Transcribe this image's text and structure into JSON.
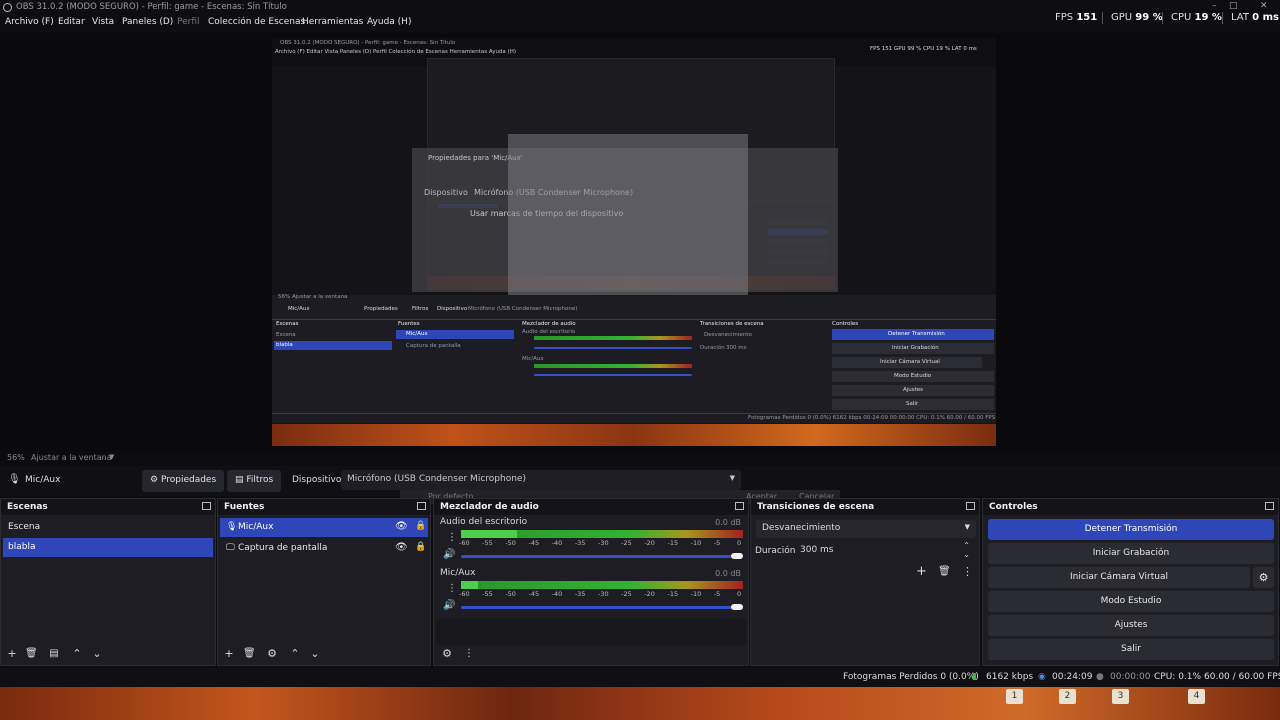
{
  "window": {
    "title": "OBS 31.0.2 (MODO SEGURO) - Perfil: game - Escenas: Sin Título",
    "controls": [
      "–",
      "□",
      "✕"
    ]
  },
  "menu": {
    "items": [
      "Archivo (F)",
      "Editar",
      "Vista",
      "Paneles (D)",
      "Perfil",
      "Colección de Escenas",
      "Herramientas",
      "Ayuda (H)"
    ]
  },
  "stats": {
    "fps_label": "FPS",
    "fps_value": "151",
    "gpu_label": "GPU",
    "gpu_value": "99 %",
    "cpu_label": "CPU",
    "cpu_value": "19 %",
    "lat_label": "LAT",
    "lat_value": "0 ms"
  },
  "preview": {
    "nested_title": "OBS 31.0.2 (MODO SEGURO) - Perfil: game - Escenas: Sin Título",
    "nested_menu": "Archivo (F)   Editar   Vista   Paneles (D)   Perfil   Colección de Escenas   Herramientas   Ayuda (H)",
    "nested_stats": "FPS 151   GPU 99 %   CPU 19 %   LAT 0 ms",
    "dialog_title": "Propiedades para 'Mic/Aux'",
    "dialog_device_label": "Dispositivo",
    "dialog_device_value": "Micrófono (USB Condenser Microphone)",
    "dialog_checkbox": "Usar marcas de tiempo del dispositivo",
    "nested_zoom": "56%   Ajustar a la ventana",
    "nested_source": "Mic/Aux",
    "nested_props": "Propiedades",
    "nested_filters": "Filtros",
    "nested_device": "Dispositivo",
    "nested_device_value": "Micrófono (USB Condenser Microphone)",
    "nested_docks": [
      "Escenas",
      "Fuentes",
      "Mezclador de audio",
      "Transiciones de escena",
      "Controles"
    ],
    "nested_scenes": [
      "Escena",
      "blabla"
    ],
    "nested_sources": [
      "Mic/Aux",
      "Captura de pantalla"
    ],
    "nested_mixer": [
      "Audio del escritorio",
      "Mic/Aux"
    ],
    "nested_transition": "Desvanecimiento",
    "nested_duration_label": "Duración",
    "nested_duration_value": "300 ms",
    "nested_controls": [
      "Detener Transmisión",
      "Iniciar Grabación",
      "Iniciar Cámara Virtual",
      "Modo Estudio",
      "Ajustes",
      "Salir"
    ],
    "nested_status": "Fotogramas Perdidos 0 (0.0%)   6162 kbps   00:24:09   00:00:00   CPU: 0.1%   60.00 / 60.00 FPS"
  },
  "zoom": {
    "percent": "56%",
    "mode": "Ajustar a la ventana"
  },
  "source_bar": {
    "source_name": "Mic/Aux",
    "properties_label": "Propiedades",
    "filters_label": "Filtros",
    "device_label": "Dispositivo",
    "device_value": "Micrófono (USB Condenser Microphone)",
    "ghost_default": "Por defecto",
    "ghost_accept": "Aceptar",
    "ghost_cancel": "Cancelar"
  },
  "scenes": {
    "title": "Escenas",
    "items": [
      "Escena",
      "blabla"
    ],
    "selected_index": 1
  },
  "sources": {
    "title": "Fuentes",
    "items": [
      "Mic/Aux",
      "Captura de pantalla"
    ],
    "selected_index": 0
  },
  "mixer": {
    "title": "Mezclador de audio",
    "channels": [
      {
        "name": "Audio del escritorio",
        "db": "0.0 dB",
        "level": 0.2,
        "volume": 1.0
      },
      {
        "name": "Mic/Aux",
        "db": "0.0 dB",
        "level": 0.06,
        "volume": 1.0
      }
    ],
    "scale": [
      "-60",
      "-55",
      "-50",
      "-45",
      "-40",
      "-35",
      "-30",
      "-25",
      "-20",
      "-15",
      "-10",
      "-5",
      "0"
    ]
  },
  "transitions": {
    "title": "Transiciones de escena",
    "selected": "Desvanecimiento",
    "duration_label": "Duración",
    "duration_value": "300 ms"
  },
  "controls": {
    "title": "Controles",
    "stop_stream": "Detener Transmisión",
    "start_recording": "Iniciar Grabación",
    "start_virtual_cam": "Iniciar Cámara Virtual",
    "studio_mode": "Modo Estudio",
    "settings": "Ajustes",
    "exit": "Salir"
  },
  "status": {
    "dropped_frames": "Fotogramas Perdidos 0 (0.0%)",
    "bitrate": "6162 kbps",
    "stream_time": "00:24:09",
    "rec_time": "00:00:00",
    "cpu": "CPU: 0.1%",
    "fps": "60.00 / 60.00 FPS"
  },
  "desktop": {
    "workspaces": [
      "1",
      "2",
      "3",
      "4"
    ]
  },
  "colors": {
    "accent": "#2f46b8",
    "panel": "#1d1d23",
    "background": "#0d0d10"
  }
}
